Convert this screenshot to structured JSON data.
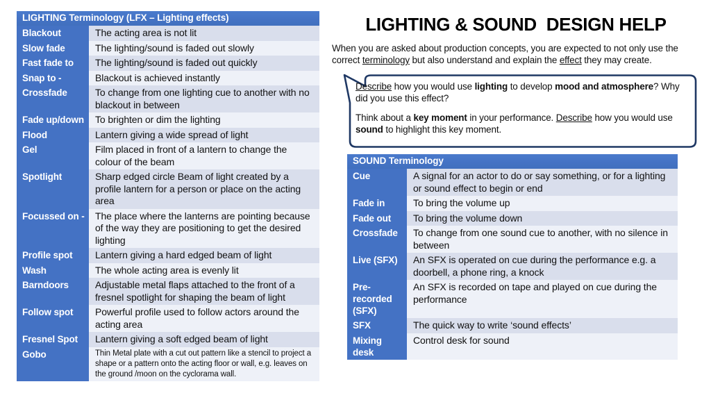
{
  "title": "LIGHTING & SOUND  DESIGN HELP",
  "intro": {
    "part1": "When you are asked about production concepts, you are expected to not only use the correct ",
    "underline1": "terminology",
    "part2": " but also understand and explain the ",
    "underline2": "effect",
    "part3": " they may create."
  },
  "bubble": {
    "p1_a": "Describe",
    "p1_b": " how you would use ",
    "p1_c": "lighting",
    "p1_d": " to develop ",
    "p1_e": "mood and atmosphere",
    "p1_f": "? Why did you use this effect?",
    "p2_a": "Think about a ",
    "p2_b": "key moment",
    "p2_c": " in your performance. ",
    "p2_d": "Describe",
    "p2_e": " how you would use ",
    "p2_f": "sound",
    "p2_g": " to highlight this key moment."
  },
  "lighting_table": {
    "header": "LIGHTING Terminology (LFX – Lighting effects)",
    "rows": [
      {
        "term": "Blackout",
        "desc": "The acting area is not lit"
      },
      {
        "term": "Slow fade",
        "desc": "The lighting/sound is faded out slowly"
      },
      {
        "term": "Fast fade to",
        "desc": "The lighting/sound is faded out quickly"
      },
      {
        "term": "Snap to -",
        "desc": "Blackout is achieved instantly"
      },
      {
        "term": "Crossfade",
        "desc": "To change from one lighting cue to another with no blackout in between"
      },
      {
        "term": "Fade up/down",
        "desc": "To brighten or dim the lighting"
      },
      {
        "term": "Flood",
        "desc": "Lantern giving a wide spread of light"
      },
      {
        "term": "Gel",
        "desc": "Film placed in front of a lantern to change the colour of the beam"
      },
      {
        "term": "Spotlight",
        "desc": "Sharp edged circle Beam of light created by a profile lantern for a person or place on the acting area"
      },
      {
        "term": "Focussed on -",
        "desc": "The place where the lanterns are pointing because of the way they are positioning to get the desired lighting"
      },
      {
        "term": "Profile spot",
        "desc": "Lantern giving a hard edged beam of light"
      },
      {
        "term": "Wash",
        "desc": "The whole acting area is evenly lit"
      },
      {
        "term": "Barndoors",
        "desc": "Adjustable metal flaps attached to the front of a fresnel spotlight for shaping the beam of light"
      },
      {
        "term": "Follow spot",
        "desc": "Powerful profile used to follow actors around the acting area"
      },
      {
        "term": "Fresnel Spot",
        "desc": "Lantern giving a soft edged beam of light"
      },
      {
        "term": "Gobo",
        "desc": "Thin Metal plate with a cut out pattern like a stencil to project a shape or a pattern onto the acting floor or wall, e.g. leaves on the ground /moon on the cyclorama wall.",
        "small": true
      }
    ]
  },
  "sound_table": {
    "header": "SOUND Terminology",
    "rows": [
      {
        "term": "Cue",
        "desc": "A signal for an actor to do or say something, or for a lighting or sound effect to begin or end"
      },
      {
        "term": "Fade in",
        "desc": "To bring the volume up"
      },
      {
        "term": "Fade out",
        "desc": "To bring the volume down"
      },
      {
        "term": "Crossfade",
        "desc": "To change from one sound cue to another, with no silence in between"
      },
      {
        "term": "Live (SFX)",
        "desc": "An SFX is operated on cue during the performance e.g. a doorbell, a phone ring, a knock"
      },
      {
        "term": "Pre-recorded (SFX)",
        "desc": "An SFX is recorded on tape and played on cue during the performance"
      },
      {
        "term": "SFX",
        "desc": "The quick way to write ‘sound effects’"
      },
      {
        "term": "Mixing desk",
        "desc": "Control desk for sound"
      }
    ]
  },
  "colors": {
    "accent_blue": "#4472C4",
    "band_light": "#EEF1F8",
    "band_dark": "#D9DEEC",
    "bubble_stroke": "#1F3864"
  }
}
